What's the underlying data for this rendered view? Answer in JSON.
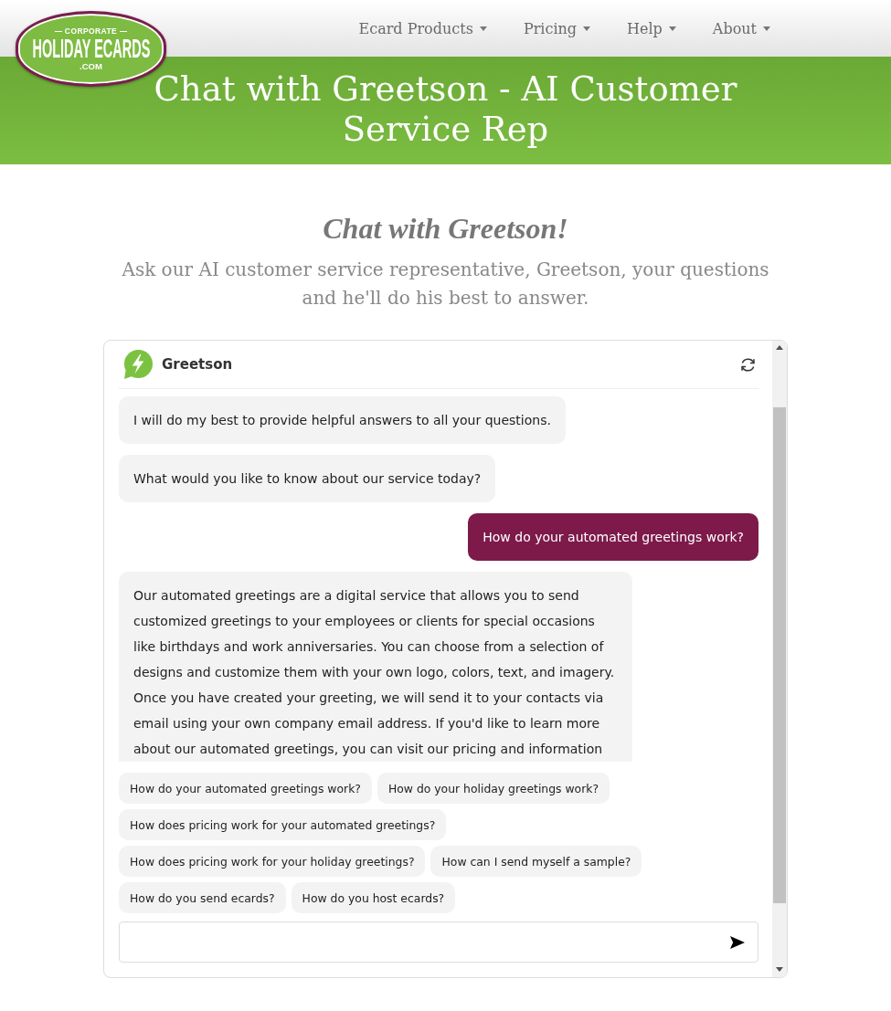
{
  "logo": {
    "top_line": "CORPORATE",
    "main_line": "HOLIDAY ECARDS",
    "bottom_line": ".COM"
  },
  "nav": [
    {
      "label": "Ecard Products",
      "dropdown": true
    },
    {
      "label": "Pricing",
      "dropdown": true
    },
    {
      "label": "Help",
      "dropdown": true
    },
    {
      "label": "About",
      "dropdown": true
    }
  ],
  "banner": {
    "title": "Chat with Greetson - AI Customer Service Rep"
  },
  "intro": {
    "heading": "Chat with Greetson!",
    "text": "Ask our AI customer service representative, Greetson, your questions and he'll do his best to answer."
  },
  "chat": {
    "bot_name": "Greetson",
    "messages": [
      {
        "kind": "bot",
        "text": "I will do my best to provide helpful answers to all your questions."
      },
      {
        "kind": "bot",
        "text": "What would you like to know about our service today?"
      },
      {
        "kind": "user",
        "text": "How do your automated greetings work?"
      },
      {
        "kind": "bot",
        "text": "Our automated greetings are a digital service that allows you to send customized greetings to your employees or clients for special occasions like birthdays and work anniversaries. You can choose from a selection of designs and customize them with your own logo, colors, text, and imagery. Once you have created your greeting, we will send it to your contacts via email using your own company email address. If you'd like to learn more about our automated greetings, you can visit our pricing and information"
      }
    ],
    "suggestions": [
      "How do your automated greetings work?",
      "How do your holiday greetings work?",
      "How does pricing work for your automated greetings?",
      "How does pricing work for your holiday greetings?",
      "How can I send myself a sample?",
      "How do you send ecards?",
      "How do you host ecards?"
    ]
  }
}
